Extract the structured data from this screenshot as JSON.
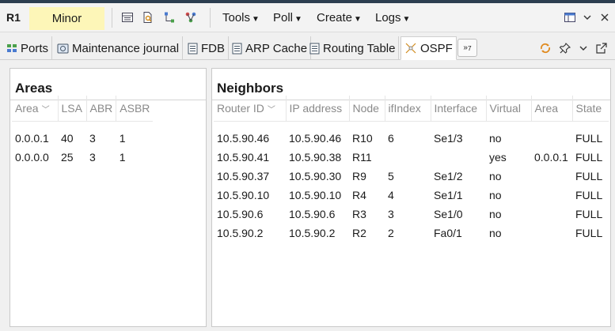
{
  "header": {
    "node_name": "R1",
    "status": "Minor",
    "menus": [
      "Tools",
      "Poll",
      "Create",
      "Logs"
    ]
  },
  "tabs": [
    {
      "label": "Ports",
      "icon": "ports-icon"
    },
    {
      "label": "Maintenance journal",
      "icon": "maintenance-journal-icon"
    },
    {
      "label": "FDB",
      "icon": "fdb-icon"
    },
    {
      "label": "ARP Cache",
      "icon": "arp-cache-icon"
    },
    {
      "label": "Routing Table",
      "icon": "routing-table-icon"
    },
    {
      "label": "OSPF",
      "icon": "ospf-icon",
      "active": true
    }
  ],
  "overflow_tabs": {
    "symbol": "»",
    "count": "7"
  },
  "areas": {
    "title": "Areas",
    "columns": [
      "Area",
      "LSA",
      "ABR",
      "ASBR"
    ],
    "rows": [
      [
        "0.0.0.1",
        "40",
        "3",
        "1"
      ],
      [
        "0.0.0.0",
        "25",
        "3",
        "1"
      ]
    ]
  },
  "neighbors": {
    "title": "Neighbors",
    "columns": [
      "Router ID",
      "IP address",
      "Node",
      "ifIndex",
      "Interface",
      "Virtual",
      "Area",
      "State"
    ],
    "rows": [
      [
        "10.5.90.46",
        "10.5.90.46",
        "R10",
        "6",
        "Se1/3",
        "no",
        "",
        "FULL"
      ],
      [
        "10.5.90.41",
        "10.5.90.38",
        "R11",
        "",
        "",
        "yes",
        "0.0.0.1",
        "FULL"
      ],
      [
        "10.5.90.37",
        "10.5.90.30",
        "R9",
        "5",
        "Se1/2",
        "no",
        "",
        "FULL"
      ],
      [
        "10.5.90.10",
        "10.5.90.10",
        "R4",
        "4",
        "Se1/1",
        "no",
        "",
        "FULL"
      ],
      [
        "10.5.90.6",
        "10.5.90.6",
        "R3",
        "3",
        "Se1/0",
        "no",
        "",
        "FULL"
      ],
      [
        "10.5.90.2",
        "10.5.90.2",
        "R2",
        "2",
        "Fa0/1",
        "no",
        "",
        "FULL"
      ]
    ]
  },
  "colors": {
    "status_minor": "#fdf6b8",
    "top_bar": "#2c3e50",
    "accent_orange": "#e08a1e"
  }
}
